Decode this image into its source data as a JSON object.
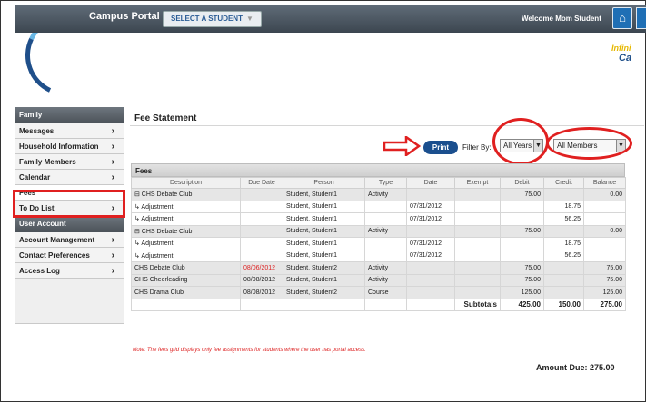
{
  "header": {
    "portal_name": "Campus Portal",
    "select_student": "SELECT A STUDENT",
    "welcome": "Welcome Mom Student",
    "brand_line1": "Infini",
    "brand_line2": "Ca"
  },
  "sidebar": {
    "family_heading": "Family",
    "family_items": [
      {
        "label": "Messages",
        "arrow": true
      },
      {
        "label": "Household Information",
        "arrow": true
      },
      {
        "label": "Family Members",
        "arrow": true
      },
      {
        "label": "Calendar",
        "arrow": true
      },
      {
        "label": "Fees",
        "arrow": false
      },
      {
        "label": "To Do List",
        "arrow": true
      }
    ],
    "account_heading": "User Account",
    "account_items": [
      {
        "label": "Account Management",
        "arrow": true
      },
      {
        "label": "Contact Preferences",
        "arrow": true
      },
      {
        "label": "Access Log",
        "arrow": true
      }
    ]
  },
  "main": {
    "title": "Fee Statement",
    "print_label": "Print",
    "filter_label": "Filter By:",
    "year_filter": "All Years",
    "member_filter": "All Members",
    "section_title": "Fees"
  },
  "fees_table": {
    "columns": [
      "Description",
      "Due Date",
      "Person",
      "Type",
      "Date",
      "Exempt",
      "Debit",
      "Credit",
      "Balance"
    ],
    "rows": [
      {
        "cls": "grp",
        "cells": [
          "⊟ CHS Debate Club",
          "",
          "Student, Student1",
          "Activity",
          "",
          "",
          "75.00",
          "",
          "0.00"
        ]
      },
      {
        "cls": "sub",
        "cells": [
          "    ↳ Adjustment",
          "",
          "Student, Student1",
          "",
          "07/31/2012",
          "",
          "",
          "18.75",
          ""
        ]
      },
      {
        "cls": "sub",
        "cells": [
          "    ↳ Adjustment",
          "",
          "Student, Student1",
          "",
          "07/31/2012",
          "",
          "",
          "56.25",
          ""
        ]
      },
      {
        "cls": "grp",
        "cells": [
          "⊟ CHS Debate Club",
          "",
          "Student, Student1",
          "Activity",
          "",
          "",
          "75.00",
          "",
          "0.00"
        ]
      },
      {
        "cls": "sub",
        "cells": [
          "    ↳ Adjustment",
          "",
          "Student, Student1",
          "",
          "07/31/2012",
          "",
          "",
          "18.75",
          ""
        ]
      },
      {
        "cls": "sub",
        "cells": [
          "    ↳ Adjustment",
          "",
          "Student, Student1",
          "",
          "07/31/2012",
          "",
          "",
          "56.25",
          ""
        ]
      },
      {
        "cls": "grp",
        "red_due": true,
        "cells": [
          "    CHS Debate Club",
          "08/06/2012",
          "Student, Student2",
          "Activity",
          "",
          "",
          "75.00",
          "",
          "75.00"
        ]
      },
      {
        "cls": "grp",
        "cells": [
          "    CHS Cheerleading",
          "08/08/2012",
          "Student, Student1",
          "Activity",
          "",
          "",
          "75.00",
          "",
          "75.00"
        ]
      },
      {
        "cls": "grp",
        "cells": [
          "    CHS Drama Club",
          "08/08/2012",
          "Student, Student2",
          "Course",
          "",
          "",
          "125.00",
          "",
          "125.00"
        ]
      }
    ],
    "totals": {
      "label": "Subtotals",
      "debit": "425.00",
      "credit": "150.00",
      "balance": "275.00"
    }
  },
  "note": "Note: The fees grid displays only fee assignments for students where the user has portal access.",
  "amount_due": "Amount Due: 275.00",
  "colors": {
    "accent": "#1b4f8e",
    "annotation": "#e02020"
  }
}
